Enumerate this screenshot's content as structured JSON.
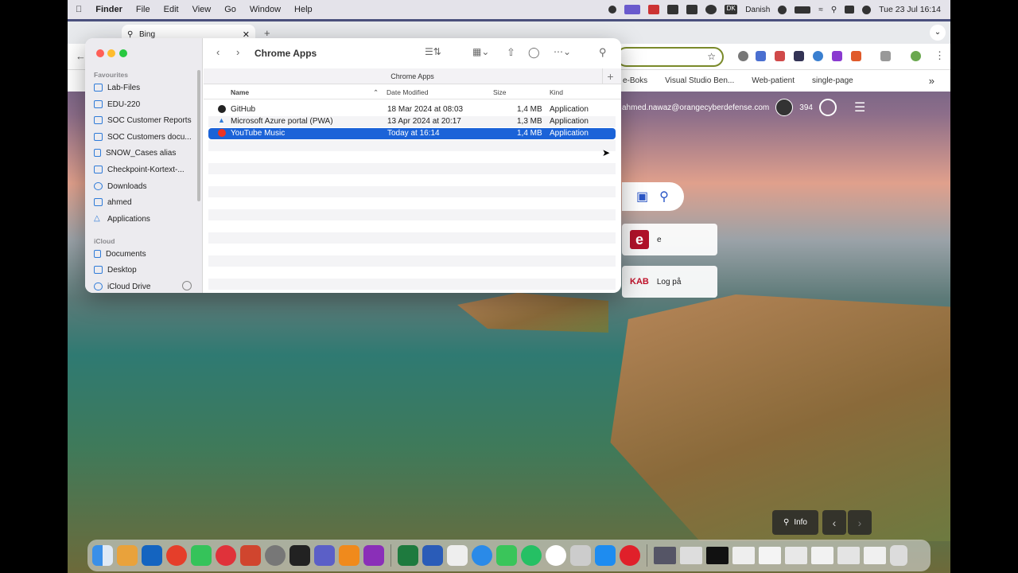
{
  "menubar": {
    "app_name": "Finder",
    "items": [
      "File",
      "Edit",
      "View",
      "Go",
      "Window",
      "Help"
    ],
    "keyboard_layout": "Danish",
    "clock": "Tue 23 Jul  16:14"
  },
  "browser": {
    "tab_title": "Bing",
    "bookmarks": [
      "e-Boks",
      "Visual Studio Ben...",
      "Web-patient",
      "single-page"
    ]
  },
  "page": {
    "user_email": "ahmed.nawaz@orangecyberdefense.com",
    "reward_points": "394",
    "tiles": [
      {
        "label": "e"
      },
      {
        "label": "Log på",
        "brand": "KAB"
      }
    ],
    "info_label": "Info"
  },
  "finder": {
    "title": "Chrome Apps",
    "path_title": "Chrome Apps",
    "sidebar": {
      "favourites_header": "Favourites",
      "favourites": [
        "Lab-Files",
        "EDU-220",
        "SOC Customer Reports",
        "SOC Customers docu...",
        "SNOW_Cases alias",
        "Checkpoint-Kortext-...",
        "Downloads",
        "ahmed",
        "Applications"
      ],
      "icloud_header": "iCloud",
      "icloud": [
        "Documents",
        "Desktop",
        "iCloud Drive"
      ]
    },
    "columns": {
      "name": "Name",
      "date": "Date Modified",
      "size": "Size",
      "kind": "Kind"
    },
    "files": [
      {
        "name": "GitHub",
        "date": "18 Mar 2024 at 08:03",
        "size": "1,4 MB",
        "kind": "Application",
        "selected": false
      },
      {
        "name": "Microsoft Azure portal (PWA)",
        "date": "13 Apr 2024 at 20:17",
        "size": "1,3 MB",
        "kind": "Application",
        "selected": false
      },
      {
        "name": "YouTube Music",
        "date": "Today at 16:14",
        "size": "1,4 MB",
        "kind": "Application",
        "selected": true
      }
    ]
  },
  "colors": {
    "selection": "#1b63d8",
    "sidebar_icon": "#2f7bd8",
    "accent_omnibox": "#7a8a2a"
  }
}
